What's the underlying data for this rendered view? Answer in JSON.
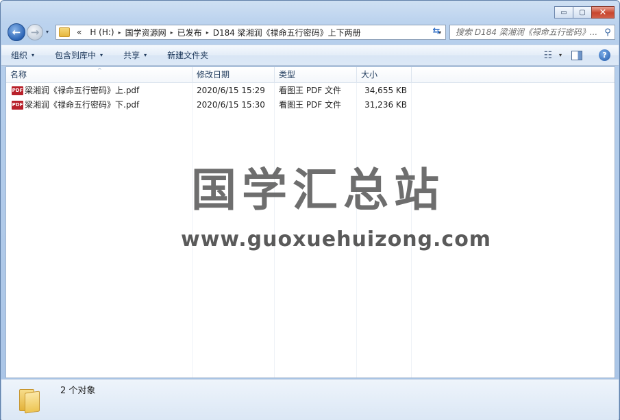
{
  "window": {
    "caption_buttons": {
      "minimize": "▭",
      "maximize": "▢",
      "close": "✕"
    }
  },
  "navigation": {
    "back_icon": "←",
    "forward_icon": "→",
    "history_icon": "▾",
    "address": {
      "overflow": "«",
      "crumbs": [
        "H (H:)",
        "国学资源网",
        "已发布",
        "D184 梁湘润《禄命五行密码》上下两册"
      ],
      "separator": "▸",
      "dropdown": "▾"
    },
    "refresh_icon": "⇆",
    "search": {
      "placeholder": "搜索 D184 梁湘润《禄命五行密码》...",
      "icon": "⚲"
    }
  },
  "toolbar": {
    "organize": "组织",
    "include_in_library": "包含到库中",
    "share": "共享",
    "new_folder": "新建文件夹",
    "caret": "▾",
    "view_icon": "☷",
    "help": "?"
  },
  "columns": {
    "name": "名称",
    "modified": "修改日期",
    "type": "类型",
    "size": "大小",
    "sort_icon": "^"
  },
  "files": [
    {
      "icon": "PDF",
      "name": "梁湘润《禄命五行密码》上.pdf",
      "modified": "2020/6/15 15:29",
      "type": "看图王 PDF 文件",
      "size": "34,655 KB"
    },
    {
      "icon": "PDF",
      "name": "梁湘润《禄命五行密码》下.pdf",
      "modified": "2020/6/15 15:30",
      "type": "看图王 PDF 文件",
      "size": "31,236 KB"
    }
  ],
  "watermark": {
    "chinese": "国学汇总站",
    "url": "www.guoxuehuizong.com"
  },
  "status": {
    "item_count": "2 个对象"
  }
}
